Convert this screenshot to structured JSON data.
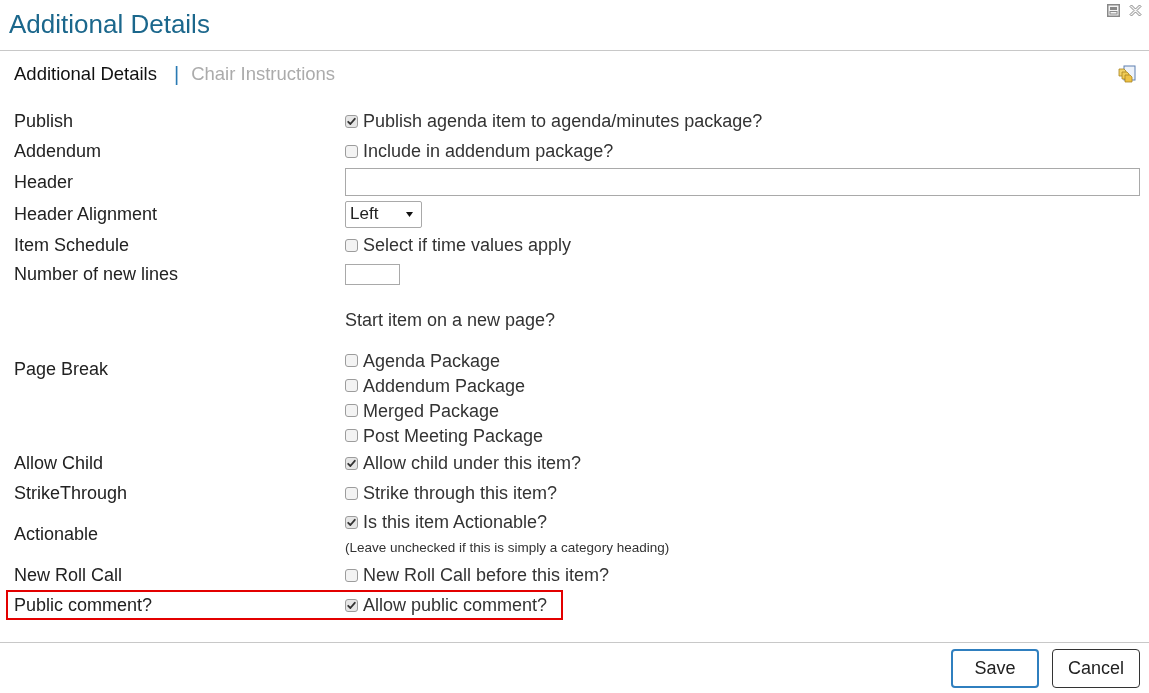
{
  "window": {
    "title": "Additional Details"
  },
  "tabs": [
    {
      "label": "Additional Details",
      "selected": true
    },
    {
      "label": "Chair Instructions",
      "selected": false
    }
  ],
  "tab_separator": "|",
  "form": {
    "rows": [
      {
        "kind": "checkbox",
        "label": "Publish",
        "highlighted": false,
        "option": {
          "text": "Publish agenda item to agenda/minutes package?",
          "checked": true
        }
      },
      {
        "kind": "checkbox",
        "label": "Addendum",
        "highlighted": false,
        "option": {
          "text": "Include in addendum package?",
          "checked": false
        }
      },
      {
        "kind": "text_input",
        "label": "Header",
        "highlighted": false
      },
      {
        "kind": "select",
        "label": "Header Alignment",
        "highlighted": false,
        "value": "Left"
      },
      {
        "kind": "checkbox",
        "label": "Item Schedule",
        "highlighted": false,
        "option": {
          "text": "Select if time values apply",
          "checked": false
        }
      },
      {
        "kind": "number_input",
        "label": "Number of new lines",
        "highlighted": false
      },
      {
        "kind": "checkbox_group",
        "label": "Page Break",
        "highlighted": false,
        "prompt": "Start item on a new page?",
        "options": [
          {
            "text": "Agenda Package",
            "checked": false
          },
          {
            "text": "Addendum Package",
            "checked": false
          },
          {
            "text": "Merged Package",
            "checked": false
          },
          {
            "text": "Post Meeting Package",
            "checked": false
          }
        ]
      },
      {
        "kind": "checkbox",
        "label": "Allow Child",
        "highlighted": false,
        "option": {
          "text": "Allow child under this item?",
          "checked": true
        }
      },
      {
        "kind": "checkbox",
        "label": "StrikeThrough",
        "highlighted": false,
        "option": {
          "text": "Strike through this item?",
          "checked": false
        }
      },
      {
        "kind": "checkbox_note",
        "label": "Actionable",
        "highlighted": false,
        "option": {
          "text": "Is this item Actionable?",
          "checked": true
        },
        "note": "(Leave unchecked if this is simply a category heading)"
      },
      {
        "kind": "checkbox",
        "label": "New Roll Call",
        "highlighted": false,
        "option": {
          "text": "New Roll Call before this item?",
          "checked": false
        }
      },
      {
        "kind": "checkbox",
        "label": "Public comment?",
        "highlighted": true,
        "option": {
          "text": "Allow public comment?",
          "checked": true
        }
      }
    ]
  },
  "buttons": [
    {
      "label": "Save",
      "kind": "primary"
    },
    {
      "label": "Cancel",
      "kind": "secondary"
    }
  ]
}
